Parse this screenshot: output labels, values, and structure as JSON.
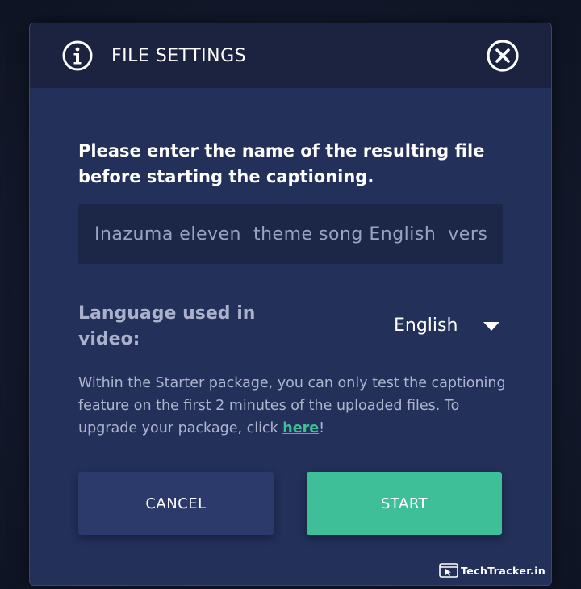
{
  "dialog": {
    "title": "FILE SETTINGS",
    "info_icon": "info-icon",
    "close_icon": "close-icon"
  },
  "prompt": "Please enter the name of the resulting file before starting the captioning.",
  "filename_input": {
    "value": "Inazuma eleven  theme song English  version"
  },
  "language": {
    "label": "Language used in video:",
    "selected": "English",
    "dropdown_icon": "caret-down-icon"
  },
  "notice": {
    "text": "Within the Starter package, you can only test the captioning feature on the first 2 minutes of the uploaded files. To upgrade your package, click ",
    "link_text": "here",
    "suffix": "!"
  },
  "buttons": {
    "cancel": "CANCEL",
    "start": "START"
  },
  "watermark": {
    "text": "TechTracker.in",
    "icon": "browser-cursor-icon"
  },
  "colors": {
    "accent": "#3fbf98",
    "header_bg": "#1b2340",
    "body_bg": "#22305a",
    "input_bg": "#1c2748",
    "cancel_bg": "#2b3a6b"
  }
}
